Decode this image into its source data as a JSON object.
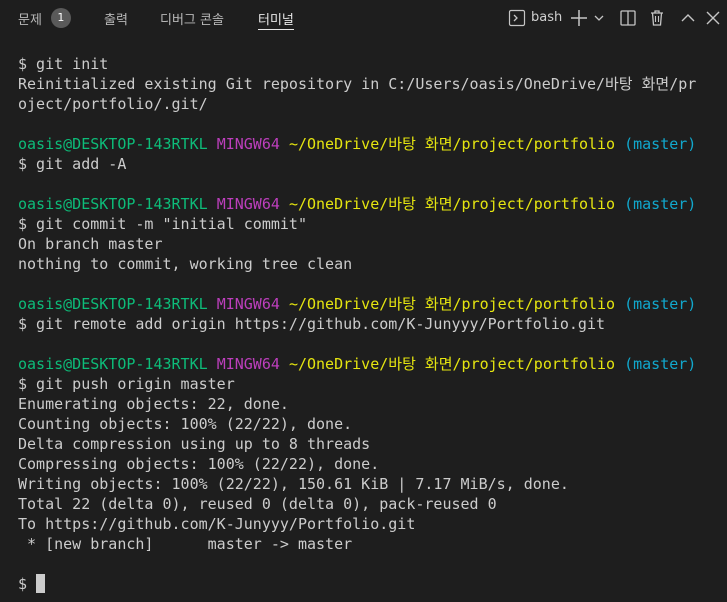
{
  "panel": {
    "tabs": [
      {
        "label": "문제",
        "badge": "1"
      },
      {
        "label": "출력"
      },
      {
        "label": "디버그 콘솔"
      },
      {
        "label": "터미널"
      }
    ],
    "shell": "bash",
    "icons": [
      "terminal-icon",
      "plus-icon",
      "chevron-down-icon",
      "split-icon",
      "trash-icon",
      "chevron-up-icon",
      "close-icon"
    ]
  },
  "colors": {
    "background": "#1e1e1e",
    "text": "#cccccc",
    "user_host": "#0dbc79",
    "env": "#bc3fbc",
    "path": "#e5e510",
    "branch": "#11a8cd"
  },
  "prompt": {
    "user_host": "oasis@DESKTOP-143RTKL",
    "env": "MINGW64",
    "path": "~/OneDrive/바탕 화면/project/portfolio",
    "branch": "(master)"
  },
  "terminal": {
    "lines": [
      "$ git init",
      "Reinitialized existing Git repository in C:/Users/oasis/OneDrive/바탕 화면/pr",
      "oject/portfolio/.git/",
      "",
      "$ git add -A",
      "",
      "$ git commit -m \"initial commit\"",
      "On branch master",
      "nothing to commit, working tree clean",
      "",
      "$ git remote add origin https://github.com/K-Junyyy/Portfolio.git",
      "",
      "$ git push origin master",
      "Enumerating objects: 22, done.",
      "Counting objects: 100% (22/22), done.",
      "Delta compression using up to 8 threads",
      "Compressing objects: 100% (22/22), done.",
      "Writing objects: 100% (22/22), 150.61 KiB | 7.17 MiB/s, done.",
      "Total 22 (delta 0), reused 0 (delta 0), pack-reused 0",
      "To https://github.com/K-Junyyy/Portfolio.git",
      " * [new branch]      master -> master",
      "",
      "$ "
    ]
  }
}
